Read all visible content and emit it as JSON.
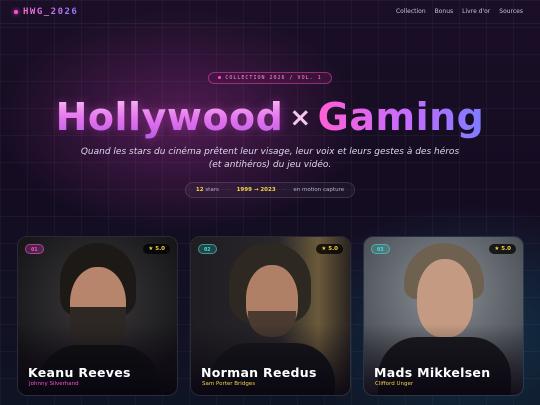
{
  "nav": {
    "logo": "HWG_2026",
    "links": [
      "Collection",
      "Bonus",
      "Livre d'or",
      "Sources"
    ]
  },
  "hero": {
    "badge": "COLLECTION 2026 / VOL. 1",
    "title_part1": "Hollywood",
    "title_sep": "×",
    "title_part2": "Gaming",
    "subtitle": "Quand les stars du cinéma prêtent leur visage, leur voix et leurs gestes à des héros (et antihéros) du jeu vidéo.",
    "stats": [
      {
        "value": "12",
        "label": "stars"
      },
      {
        "value": "1999 → 2023",
        "label": ""
      },
      {
        "value": "",
        "label": "en motion capture"
      }
    ]
  },
  "cards": [
    {
      "number": "01",
      "rating": "★ 5.0",
      "name": "Keanu Reeves",
      "role": "Johnny Silverhand",
      "accent": "#ff4fd8"
    },
    {
      "number": "02",
      "rating": "★ 5.0",
      "name": "Norman Reedus",
      "role": "Sam Porter Bridges",
      "accent": "#3ee8e0"
    },
    {
      "number": "03",
      "rating": "★ 5.0",
      "name": "Mads Mikkelsen",
      "role": "Clifford Unger",
      "accent": "#3ee8e0"
    }
  ],
  "colors": {
    "pink": "#ff4fd8",
    "cyan": "#3ee8e0",
    "gold": "#f6d34a"
  }
}
